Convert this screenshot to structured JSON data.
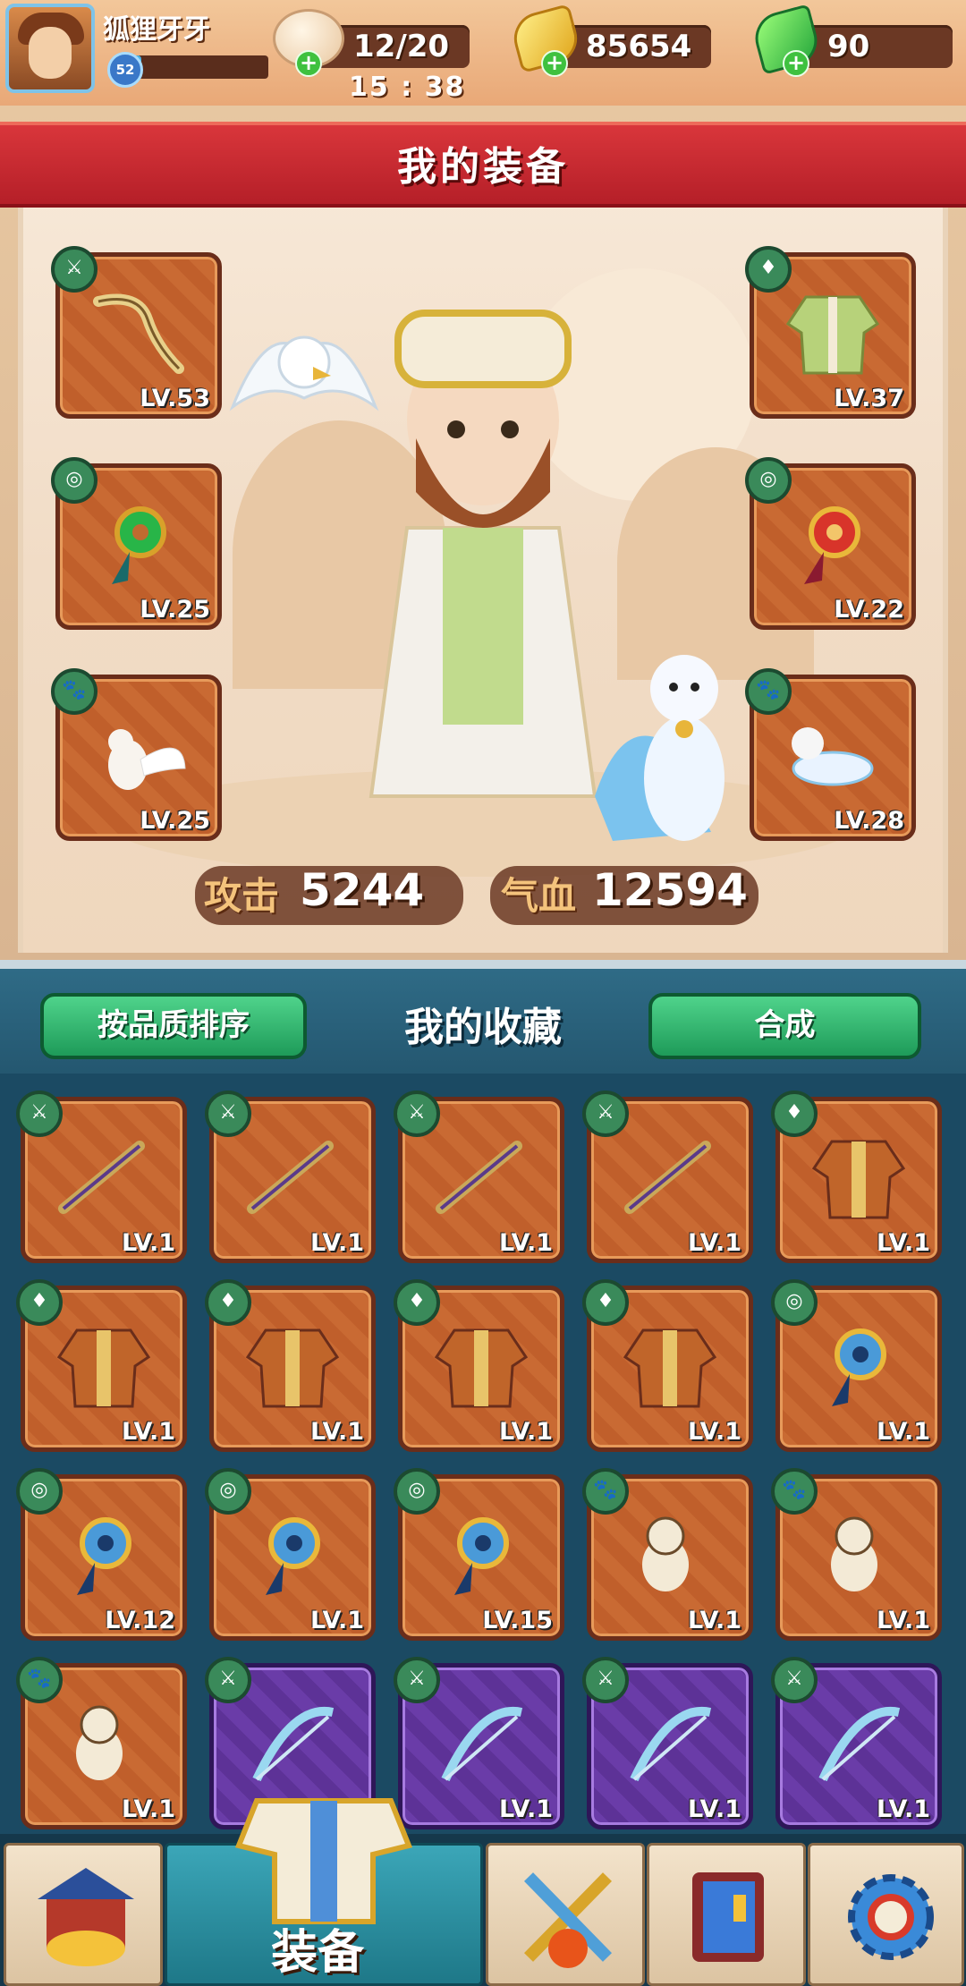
{
  "player": {
    "name": "狐狸牙牙",
    "level": "52",
    "exp_fraction": 0.05
  },
  "resources": {
    "energy": "12/20",
    "timer": "15 : 38",
    "gold": "85654",
    "jade": "90"
  },
  "equipment_panel": {
    "title": "我的装备",
    "slots": [
      {
        "slot": "weapon",
        "icon": "sword-tag-icon",
        "level": "LV.53"
      },
      {
        "slot": "amulet",
        "icon": "amulet-tag-icon",
        "level": "LV.25"
      },
      {
        "slot": "pet",
        "icon": "paw-tag-icon",
        "level": "LV.25"
      },
      {
        "slot": "armor",
        "icon": "armor-tag-icon",
        "level": "LV.37"
      },
      {
        "slot": "amulet",
        "icon": "amulet-tag-icon",
        "level": "LV.22"
      },
      {
        "slot": "pet",
        "icon": "paw-tag-icon",
        "level": "LV.28"
      }
    ],
    "stats": {
      "attack_label": "攻击",
      "attack": "5244",
      "hp_label": "气血",
      "hp": "12594"
    }
  },
  "collection": {
    "sort_button": "按品质排序",
    "title": "我的收藏",
    "merge_button": "合成",
    "items": [
      {
        "type": "weapon",
        "level": "LV.1",
        "rarity": "orange"
      },
      {
        "type": "weapon",
        "level": "LV.1",
        "rarity": "orange"
      },
      {
        "type": "weapon",
        "level": "LV.1",
        "rarity": "orange"
      },
      {
        "type": "weapon",
        "level": "LV.1",
        "rarity": "orange"
      },
      {
        "type": "armor",
        "level": "LV.1",
        "rarity": "orange"
      },
      {
        "type": "armor",
        "level": "LV.1",
        "rarity": "orange"
      },
      {
        "type": "armor",
        "level": "LV.1",
        "rarity": "orange"
      },
      {
        "type": "armor",
        "level": "LV.1",
        "rarity": "orange"
      },
      {
        "type": "armor",
        "level": "LV.1",
        "rarity": "orange"
      },
      {
        "type": "amulet",
        "level": "LV.1",
        "rarity": "orange"
      },
      {
        "type": "amulet",
        "level": "LV.12",
        "rarity": "orange"
      },
      {
        "type": "amulet",
        "level": "LV.1",
        "rarity": "orange"
      },
      {
        "type": "amulet",
        "level": "LV.15",
        "rarity": "orange"
      },
      {
        "type": "pet",
        "level": "LV.1",
        "rarity": "orange"
      },
      {
        "type": "pet",
        "level": "LV.1",
        "rarity": "orange"
      },
      {
        "type": "pet",
        "level": "LV.1",
        "rarity": "orange"
      },
      {
        "type": "weapon",
        "level": "LV.1",
        "rarity": "purple"
      },
      {
        "type": "weapon",
        "level": "LV.1",
        "rarity": "purple"
      },
      {
        "type": "weapon",
        "level": "LV.1",
        "rarity": "purple"
      },
      {
        "type": "weapon",
        "level": "LV.1",
        "rarity": "purple"
      }
    ]
  },
  "nav": {
    "tabs": [
      {
        "name": "shop-tab",
        "icon": "treasure-shop-icon"
      },
      {
        "name": "equipment-tab",
        "icon": "equipment-icon",
        "label": "装备",
        "active": true
      },
      {
        "name": "battle-tab",
        "icon": "crossed-weapons-icon"
      },
      {
        "name": "book-tab",
        "icon": "book-icon"
      },
      {
        "name": "settings-tab",
        "icon": "gear-icon"
      }
    ]
  },
  "colors": {
    "banner_red": "#c8262e",
    "button_green": "#2fb26a",
    "orange_slot": "#c96a33",
    "purple_slot": "#6a3ca8"
  }
}
